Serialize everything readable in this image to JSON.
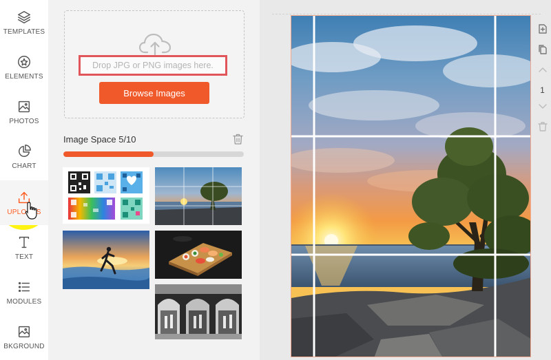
{
  "nav": {
    "items": [
      {
        "label": "TEMPLATES",
        "icon": "layers-icon"
      },
      {
        "label": "ELEMENTS",
        "icon": "elements-icon"
      },
      {
        "label": "PHOTOS",
        "icon": "photo-icon"
      },
      {
        "label": "CHART",
        "icon": "pie-chart-icon"
      },
      {
        "label": "UPLOADS",
        "icon": "upload-icon"
      },
      {
        "label": "TEXT",
        "icon": "text-icon"
      },
      {
        "label": "MODULES",
        "icon": "list-icon"
      },
      {
        "label": "BKGROUND",
        "icon": "background-icon"
      }
    ],
    "active": "UPLOADS",
    "accent": "#ff5a1f"
  },
  "upload": {
    "drop_text": "Drop JPG or PNG images here.",
    "browse_label": "Browse Images",
    "space_label": "Image Space 5/10",
    "space_used": 5,
    "space_total": 10,
    "button_color": "#f05a2a",
    "highlight_color": "#e0565a"
  },
  "thumbnails": [
    {
      "name": "qr-codes"
    },
    {
      "name": "sunset-tree-grid"
    },
    {
      "name": "runner-beach"
    },
    {
      "name": "sushi-platter"
    },
    {
      "name": "shop-arcade"
    }
  ],
  "page_indicator": "1"
}
